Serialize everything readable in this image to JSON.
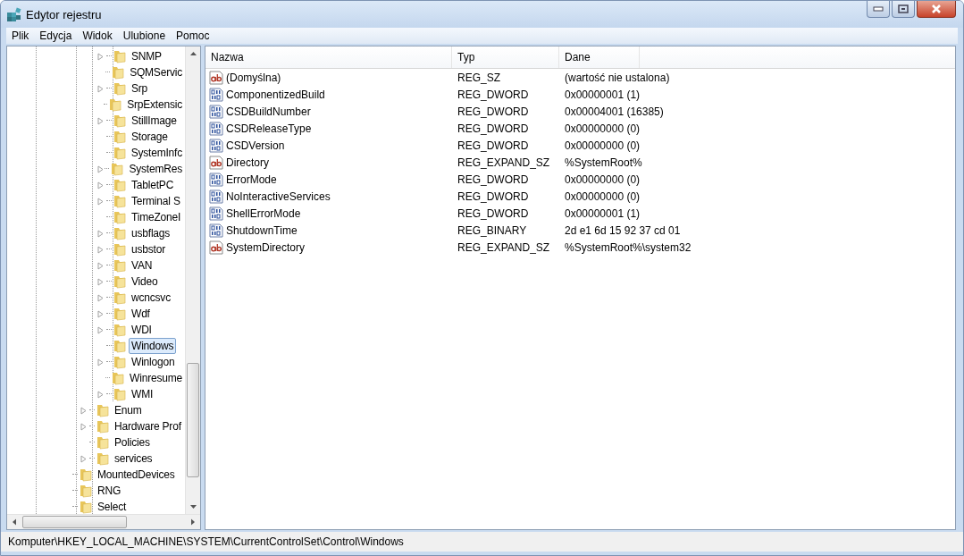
{
  "window": {
    "title": "Edytor rejestru"
  },
  "menu": [
    "Plik",
    "Edycja",
    "Widok",
    "Ulubione",
    "Pomoc"
  ],
  "tree": {
    "items": [
      {
        "children": [
          {
            "children": [
              {
                "label": "SNMP",
                "expandable": true,
                "selected": false
              },
              {
                "label": "SQMServic",
                "expandable": false,
                "selected": false
              },
              {
                "label": "Srp",
                "expandable": true,
                "selected": false
              },
              {
                "label": "SrpExtensic",
                "expandable": false,
                "selected": false
              },
              {
                "label": "StillImage",
                "expandable": true,
                "selected": false
              },
              {
                "label": "Storage",
                "expandable": false,
                "selected": false
              },
              {
                "label": "SystemInfc",
                "expandable": false,
                "selected": false
              },
              {
                "label": "SystemRes",
                "expandable": true,
                "selected": false
              },
              {
                "label": "TabletPC",
                "expandable": true,
                "selected": false
              },
              {
                "label": "Terminal S",
                "expandable": true,
                "selected": false
              },
              {
                "label": "TimeZoneI",
                "expandable": false,
                "selected": false
              },
              {
                "label": "usbflags",
                "expandable": true,
                "selected": false
              },
              {
                "label": "usbstor",
                "expandable": true,
                "selected": false
              },
              {
                "label": "VAN",
                "expandable": true,
                "selected": false
              },
              {
                "label": "Video",
                "expandable": true,
                "selected": false
              },
              {
                "label": "wcncsvc",
                "expandable": true,
                "selected": false
              },
              {
                "label": "Wdf",
                "expandable": true,
                "selected": false
              },
              {
                "label": "WDI",
                "expandable": true,
                "selected": false
              },
              {
                "label": "Windows",
                "expandable": false,
                "selected": true
              },
              {
                "label": "Winlogon",
                "expandable": true,
                "selected": false
              },
              {
                "label": "Winresume",
                "expandable": false,
                "selected": false
              },
              {
                "label": "WMI",
                "expandable": true,
                "selected": false
              }
            ]
          },
          {
            "label": "Enum",
            "expandable": true,
            "selected": false
          },
          {
            "label": "Hardware Prof",
            "expandable": true,
            "selected": false
          },
          {
            "label": "Policies",
            "expandable": false,
            "selected": false
          },
          {
            "label": "services",
            "expandable": true,
            "selected": false
          }
        ]
      },
      {
        "label": "MountedDevices",
        "expandable": false,
        "selected": false
      },
      {
        "label": "RNG",
        "expandable": false,
        "selected": false
      },
      {
        "label": "Select",
        "expandable": false,
        "selected": false
      }
    ]
  },
  "table": {
    "columns": [
      "Nazwa",
      "Typ",
      "Dane"
    ],
    "rows": [
      {
        "kind": "string",
        "name": "(Domyślna)",
        "type": "REG_SZ",
        "data": "(wartość nie ustalona)"
      },
      {
        "kind": "binary",
        "name": "ComponentizedBuild",
        "type": "REG_DWORD",
        "data": "0x00000001 (1)"
      },
      {
        "kind": "binary",
        "name": "CSDBuildNumber",
        "type": "REG_DWORD",
        "data": "0x00004001 (16385)"
      },
      {
        "kind": "binary",
        "name": "CSDReleaseType",
        "type": "REG_DWORD",
        "data": "0x00000000 (0)"
      },
      {
        "kind": "binary",
        "name": "CSDVersion",
        "type": "REG_DWORD",
        "data": "0x00000000 (0)"
      },
      {
        "kind": "string",
        "name": "Directory",
        "type": "REG_EXPAND_SZ",
        "data": "%SystemRoot%"
      },
      {
        "kind": "binary",
        "name": "ErrorMode",
        "type": "REG_DWORD",
        "data": "0x00000000 (0)"
      },
      {
        "kind": "binary",
        "name": "NoInteractiveServices",
        "type": "REG_DWORD",
        "data": "0x00000000 (0)"
      },
      {
        "kind": "binary",
        "name": "ShellErrorMode",
        "type": "REG_DWORD",
        "data": "0x00000001 (1)"
      },
      {
        "kind": "binary",
        "name": "ShutdownTime",
        "type": "REG_BINARY",
        "data": "2d e1 6d 15 92 37 cd 01"
      },
      {
        "kind": "string",
        "name": "SystemDirectory",
        "type": "REG_EXPAND_SZ",
        "data": "%SystemRoot%\\system32"
      }
    ]
  },
  "status_bar": "Komputer\\HKEY_LOCAL_MACHINE\\SYSTEM\\CurrentControlSet\\Control\\Windows"
}
